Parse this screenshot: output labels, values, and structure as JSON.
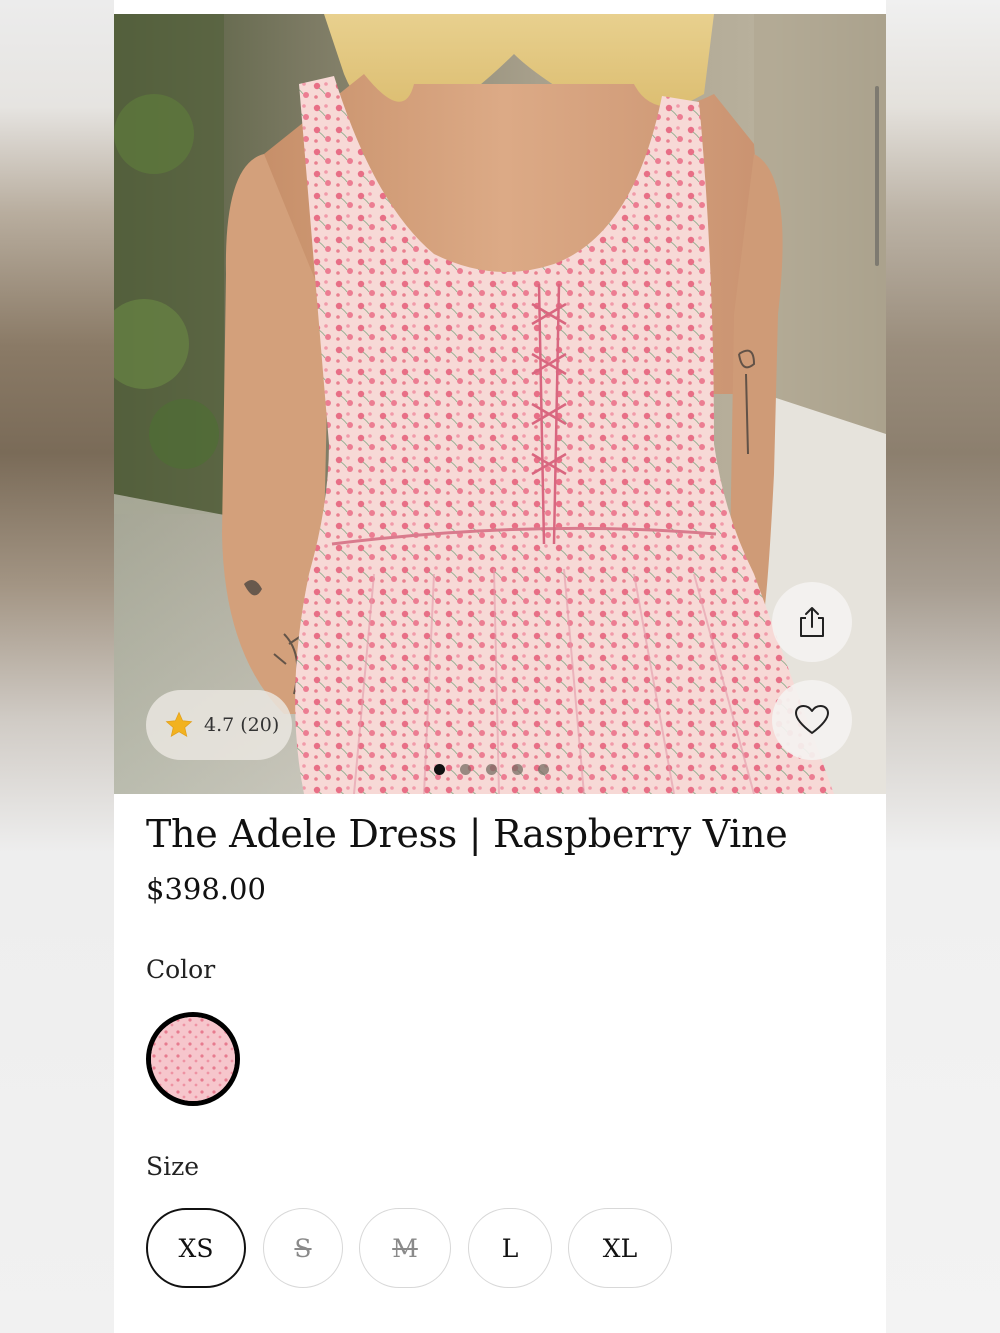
{
  "product": {
    "title": "The Adele Dress | Raspberry Vine",
    "price": "$398.00",
    "rating": "4.7 (20)",
    "image_count": 5,
    "active_image_index": 0
  },
  "icons": {
    "rating": "star-icon",
    "share": "share-icon",
    "wishlist": "heart-icon"
  },
  "color": {
    "label": "Color",
    "selected": "Raspberry Vine",
    "swatch_color": "#f2b8c2"
  },
  "size": {
    "label": "Size",
    "options": [
      {
        "label": "XS",
        "selected": true,
        "available": true
      },
      {
        "label": "S",
        "selected": false,
        "available": false
      },
      {
        "label": "M",
        "selected": false,
        "available": false
      },
      {
        "label": "L",
        "selected": false,
        "available": true
      },
      {
        "label": "XL",
        "selected": false,
        "available": true
      }
    ]
  },
  "colors": {
    "dress_pink": "#f0a7b3",
    "star_gold": "#f2b21f"
  }
}
